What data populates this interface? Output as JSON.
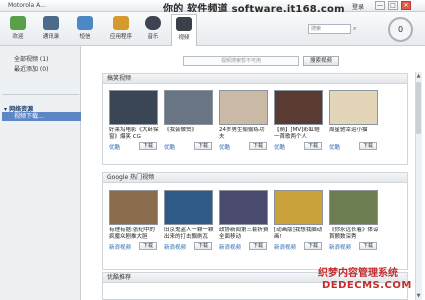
{
  "window": {
    "title": "Motorola A...",
    "login": "登录",
    "controls": [
      "—",
      "□",
      "✕"
    ]
  },
  "watermark_top": "你的 软件频道 software.it168.com",
  "toolbar": {
    "tools": [
      {
        "label": "欢迎",
        "icon": "welcome-icon",
        "color": "#5aa04a"
      },
      {
        "label": "通讯录",
        "icon": "contacts-icon",
        "color": "#4a6b8a"
      },
      {
        "label": "短信",
        "icon": "sms-icon",
        "color": "#4c88c4"
      },
      {
        "label": "应用程序",
        "icon": "apps-icon",
        "color": "#d59a2c"
      },
      {
        "label": "音乐",
        "icon": "music-icon",
        "color": "#3e4550"
      },
      {
        "label": "视频",
        "icon": "video-icon",
        "color": "#3b4048"
      }
    ],
    "search_placeholder": "搜索",
    "device_count": "0"
  },
  "sidebar": {
    "items": [
      "全部视频 (1)",
      "最近添加 (0)"
    ],
    "section": "网络资源",
    "selected": "视频下载..."
  },
  "main": {
    "search_placeholder": "视频搜索暂不可用",
    "search_button": "搜索视频",
    "sections": [
      {
        "title": "搞笑视频",
        "cards": [
          {
            "title": "好莱坞电影《大卧探窗》爆笑 CG",
            "source": "优酷",
            "download": "下载"
          },
          {
            "title": "《我会做赞》",
            "source": "优酷",
            "download": "下载"
          },
          {
            "title": "24岁男生偷偷练功夫",
            "source": "优酷",
            "download": "下载"
          },
          {
            "title": "【萌】[MV]彩虹蛙 一首歌两个人",
            "source": "优酷",
            "download": "下载"
          },
          {
            "title": "周星驰幸运小猫",
            "source": "优酷",
            "download": "下载"
          }
        ]
      },
      {
        "title": "Google 热门视频",
        "cards": [
          {
            "title": "有理有据:张纪中的疯魔众剧推大胆",
            "source": "新浪视频",
            "download": "下载"
          },
          {
            "title": "旧京鬼盗人一颗一颗出来的打击飘刷瓦",
            "source": "新浪视频",
            "download": "下载"
          },
          {
            "title": "政协新闻第三套折费全面移动",
            "source": "新浪视频",
            "download": "下载"
          },
          {
            "title": "[动画版]我想我脑动画!",
            "source": "新浪视频",
            "download": "下载"
          },
          {
            "title": "《你永远长着》体谅 首颤数深秀",
            "source": "新浪视频",
            "download": "下载"
          }
        ]
      },
      {
        "title": "优酷推荐",
        "cards": []
      }
    ]
  },
  "watermark_bottom": {
    "cn": "织梦内容管理系统",
    "en": "DEDECMS.COM"
  },
  "thumb_colors": [
    [
      "#3a4656",
      "#6a7584",
      "#c9b9a5",
      "#5a3b34",
      "#e2d5b8"
    ],
    [
      "#8b6d4e",
      "#2f5a88",
      "#4a4a6e",
      "#c9a23b",
      "#6d7d52"
    ]
  ]
}
